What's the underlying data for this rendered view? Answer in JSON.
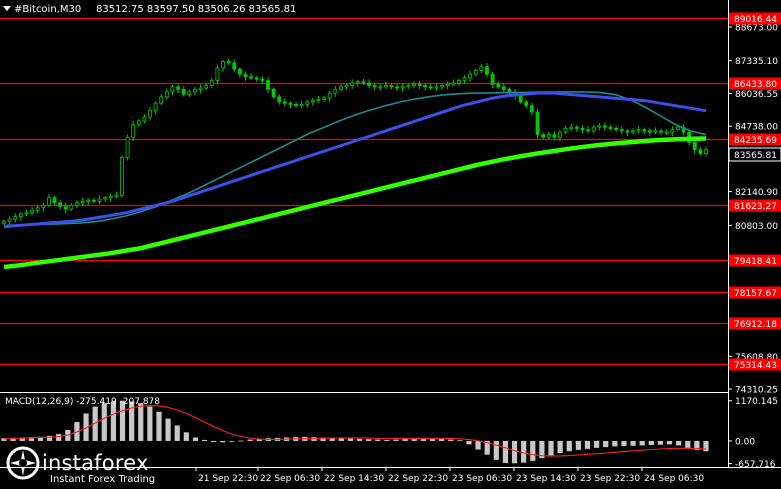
{
  "header": {
    "symbol": "#Bitcoin,M30",
    "ohlc": "83512.75 83597.50 83506.26 83565.81",
    "dropdown_icon": "triangle-down-icon"
  },
  "macd": {
    "label": "MACD(12,26,9) -275.419 -207.878"
  },
  "colors": {
    "background": "#000000",
    "candle": "#00c800",
    "level_line": "#ff0000",
    "level_label_bg": "#ff0000",
    "ma_fast": "#1e8a8a",
    "ma_mid": "#3c50e6",
    "ma_slow": "#32ff00",
    "histogram": "#c8c8c8",
    "signal": "#ff2020",
    "axis_text": "#ffffff"
  },
  "price_axis": {
    "ticks": [
      "88673.00",
      "87335.10",
      "86036.55",
      "84738.00",
      "83565.81",
      "82140.90",
      "80803.00",
      "75608.80",
      "74310.25"
    ]
  },
  "macd_axis": {
    "ticks": [
      "1170.145",
      "0.00",
      "-657.716"
    ]
  },
  "levels": [
    {
      "label": "89016.44",
      "value": 89016.44
    },
    {
      "label": "86433.80",
      "value": 86433.8
    },
    {
      "label": "84235.69",
      "value": 84235.69
    },
    {
      "label": "81623.27",
      "value": 81623.27
    },
    {
      "label": "79418.41",
      "value": 79418.41
    },
    {
      "label": "78157.67",
      "value": 78157.67
    },
    {
      "label": "76912.18",
      "value": 76912.18
    },
    {
      "label": "75314.43",
      "value": 75314.43
    }
  ],
  "time_axis": {
    "labels": [
      "21 Sep 22:30",
      "22 Sep 06:30",
      "22 Sep 14:30",
      "22 Sep 22:30",
      "23 Sep 06:30",
      "23 Sep 14:30",
      "23 Sep 22:30",
      "24 Sep 06:30"
    ]
  },
  "logo": {
    "name": "instaforex",
    "tagline": "Instant Forex Trading"
  },
  "chart_data": {
    "type": "candlestick",
    "current_price": 83565.81,
    "ylim": [
      74310.25,
      89400
    ],
    "closes": [
      80950,
      81050,
      81150,
      81250,
      81300,
      81400,
      81500,
      81600,
      81900,
      81700,
      81550,
      81450,
      81600,
      81700,
      81750,
      81800,
      81750,
      81850,
      81900,
      81950,
      82000,
      83500,
      84300,
      84800,
      84950,
      85100,
      85350,
      85650,
      85900,
      86100,
      86300,
      86200,
      86000,
      86100,
      86200,
      86250,
      86350,
      86550,
      87050,
      87300,
      87250,
      87000,
      86800,
      86700,
      86650,
      86600,
      86550,
      86200,
      85900,
      85700,
      85650,
      85600,
      85550,
      85600,
      85700,
      85750,
      85800,
      85850,
      86050,
      86200,
      86300,
      86350,
      86450,
      86500,
      86450,
      86350,
      86300,
      86300,
      86350,
      86300,
      86250,
      86300,
      86350,
      86400,
      86350,
      86300,
      86250,
      86300,
      86350,
      86400,
      86450,
      86550,
      86650,
      86800,
      86950,
      87100,
      86800,
      86400,
      86300,
      86200,
      86100,
      85950,
      85700,
      85550,
      85300,
      84400,
      84300,
      84400,
      84300,
      84500,
      84650,
      84700,
      84650,
      84600,
      84550,
      84700,
      84750,
      84700,
      84650,
      84600,
      84550,
      84500,
      84550,
      84600,
      84550,
      84500,
      84550,
      84500,
      84500,
      84600,
      84700,
      84500,
      84100,
      83800,
      83650,
      83800
    ],
    "ma_fast": [
      80800,
      80820,
      80840,
      80850,
      80870,
      80900,
      80950,
      81050,
      81180,
      81350,
      81550,
      81800,
      82050,
      82350,
      82650,
      82950,
      83250,
      83550,
      83850,
      84150,
      84450,
      84700,
      84950,
      85180,
      85380,
      85550,
      85700,
      85820,
      85920,
      85990,
      86030,
      86050,
      86060,
      86070,
      86080,
      86090,
      86090,
      86100,
      86100,
      86080,
      86000,
      85800,
      85500,
      85150,
      84800,
      84550,
      84400
    ],
    "ma_mid": [
      80750,
      80800,
      80850,
      80900,
      80950,
      81000,
      81100,
      81200,
      81300,
      81450,
      81600,
      81750,
      81950,
      82150,
      82350,
      82550,
      82750,
      82950,
      83150,
      83350,
      83550,
      83750,
      83950,
      84150,
      84350,
      84550,
      84750,
      84950,
      85150,
      85350,
      85550,
      85700,
      85850,
      85950,
      86000,
      86050,
      86050,
      86000,
      85950,
      85900,
      85850,
      85800,
      85750,
      85650,
      85550,
      85450,
      85350
    ],
    "ma_slow": [
      79150,
      79220,
      79300,
      79380,
      79460,
      79540,
      79620,
      79700,
      79800,
      79900,
      80050,
      80200,
      80350,
      80500,
      80650,
      80800,
      80950,
      81100,
      81250,
      81400,
      81550,
      81700,
      81850,
      82000,
      82150,
      82300,
      82450,
      82600,
      82750,
      82900,
      83050,
      83200,
      83330,
      83450,
      83560,
      83660,
      83750,
      83840,
      83920,
      83990,
      84050,
      84100,
      84150,
      84190,
      84220,
      84240,
      84250
    ],
    "macd_histogram": [
      80,
      90,
      100,
      110,
      120,
      150,
      200,
      320,
      550,
      800,
      1000,
      1100,
      1150,
      1170,
      1150,
      1100,
      1000,
      850,
      650,
      450,
      250,
      100,
      30,
      -30,
      -40,
      -20,
      10,
      40,
      60,
      80,
      90,
      100,
      110,
      120,
      110,
      100,
      90,
      80,
      70,
      60,
      50,
      40,
      30,
      40,
      60,
      80,
      90,
      80,
      60,
      40,
      20,
      -100,
      -250,
      -400,
      -550,
      -640,
      -650,
      -630,
      -580,
      -500,
      -420,
      -350,
      -300,
      -260,
      -230,
      -200,
      -180,
      -160,
      -150,
      -140,
      -130,
      -120,
      -110,
      -100,
      -130,
      -200,
      -260,
      -300
    ],
    "macd_signal": [
      60,
      70,
      80,
      90,
      100,
      110,
      130,
      170,
      260,
      380,
      520,
      660,
      780,
      880,
      960,
      1010,
      1030,
      1020,
      980,
      900,
      800,
      680,
      550,
      420,
      300,
      200,
      130,
      80,
      55,
      45,
      45,
      50,
      58,
      65,
      72,
      78,
      82,
      84,
      84,
      82,
      79,
      75,
      71,
      68,
      67,
      68,
      70,
      71,
      71,
      68,
      62,
      40,
      5,
      -50,
      -120,
      -200,
      -280,
      -350,
      -400,
      -430,
      -440,
      -435,
      -425,
      -410,
      -390,
      -370,
      -350,
      -330,
      -310,
      -290,
      -270,
      -250,
      -235,
      -220,
      -215,
      -215,
      -220,
      -230
    ],
    "macd_ylim": [
      -700,
      1250
    ]
  }
}
